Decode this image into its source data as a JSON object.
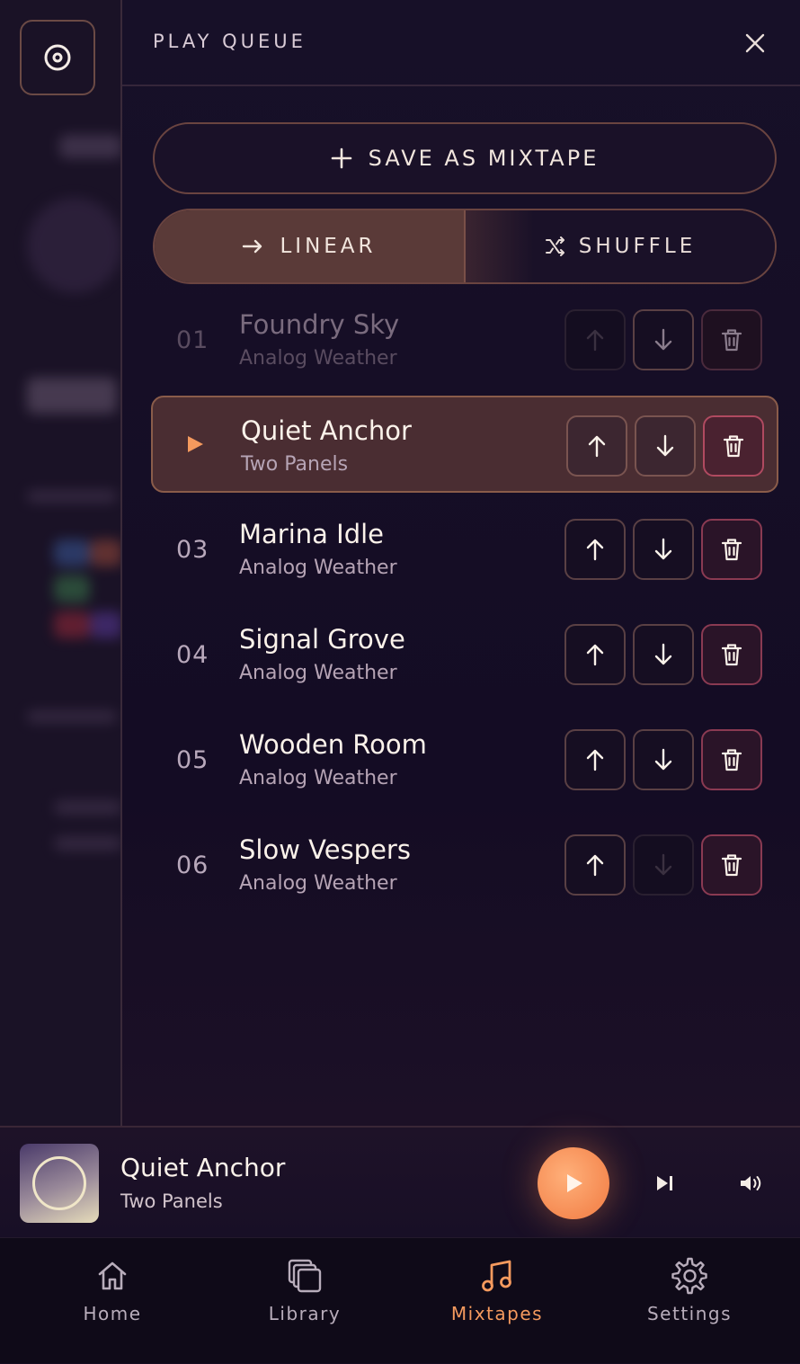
{
  "queue": {
    "title": "PLAY QUEUE",
    "save_label": "SAVE AS MIXTAPE",
    "modes": {
      "linear": "LINEAR",
      "shuffle": "SHUFFLE",
      "selected": "linear"
    },
    "tracks": [
      {
        "num": "01",
        "title": "Foundry Sky",
        "artist": "Analog Weather",
        "state": "played"
      },
      {
        "num": "",
        "title": "Quiet Anchor",
        "artist": "Two Panels",
        "state": "playing"
      },
      {
        "num": "03",
        "title": "Marina Idle",
        "artist": "Analog Weather",
        "state": "upcoming"
      },
      {
        "num": "04",
        "title": "Signal Grove",
        "artist": "Analog Weather",
        "state": "upcoming"
      },
      {
        "num": "05",
        "title": "Wooden Room",
        "artist": "Analog Weather",
        "state": "upcoming"
      },
      {
        "num": "06",
        "title": "Slow Vespers",
        "artist": "Analog Weather",
        "state": "upcoming"
      }
    ]
  },
  "player": {
    "title": "Quiet Anchor",
    "artist": "Two Panels"
  },
  "nav": {
    "items": [
      {
        "label": "Home",
        "icon": "home-icon"
      },
      {
        "label": "Library",
        "icon": "library-icon"
      },
      {
        "label": "Mixtapes",
        "icon": "music-note-icon"
      },
      {
        "label": "Settings",
        "icon": "gear-icon"
      }
    ],
    "active": "Mixtapes"
  },
  "colors": {
    "accent": "#f58a52",
    "delete": "#b04a60",
    "panel": "#171028"
  }
}
